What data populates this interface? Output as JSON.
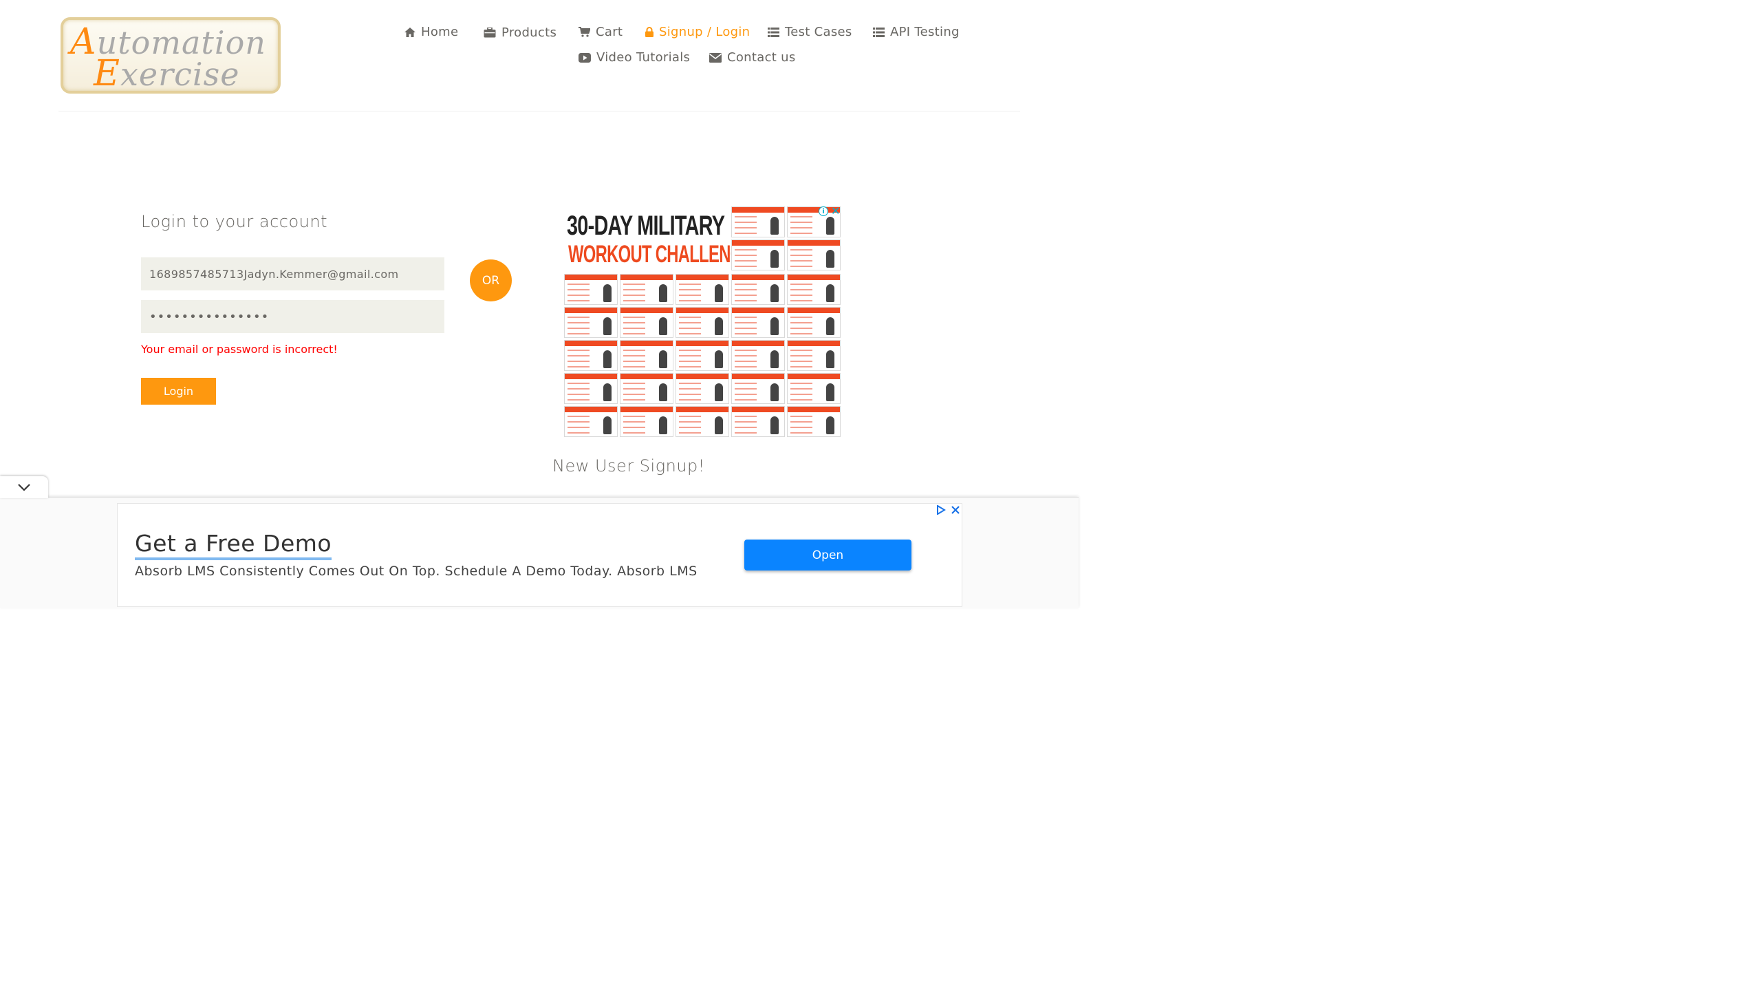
{
  "brand": {
    "logo_line1_cap": "A",
    "logo_line1_rest": "utomation",
    "logo_line2_cap": "E",
    "logo_line2_rest": "xercise"
  },
  "nav": {
    "home": "Home",
    "products": "Products",
    "cart": "Cart",
    "signup_login": "Signup / Login",
    "test_cases": "Test Cases",
    "api_testing": "API Testing",
    "video_tutorials": "Video Tutorials",
    "contact_us": "Contact us"
  },
  "login": {
    "title": "Login to your account",
    "email_value": "1689857485713Jadyn.Kemmer@gmail.com",
    "password_value": "•••••••••••••••",
    "error": "Your email or password is incorrect!",
    "button": "Login"
  },
  "or_label": "OR",
  "side_ad": {
    "line1": "30-DAY MILITARY",
    "line2": "WORKOUT CHALLENGE",
    "info": "i",
    "close": "✕"
  },
  "signup": {
    "title": "New User Signup!"
  },
  "bottom_ad": {
    "headline": "Get a Free Demo",
    "body": "Absorb LMS Consistently Comes Out On Top. Schedule A Demo Today. Absorb LMS",
    "button": "Open"
  },
  "colors": {
    "accent": "#fe980f",
    "error": "#ff0000",
    "field_bg": "#f0f0e9",
    "ad_button": "#0a84ff"
  },
  "icons": [
    "home-icon",
    "briefcase-icon",
    "cart-icon",
    "lock-icon",
    "list-icon",
    "youtube-play-icon",
    "envelope-icon",
    "chevron-down-icon",
    "adchoices-icon",
    "close-icon",
    "info-icon"
  ]
}
